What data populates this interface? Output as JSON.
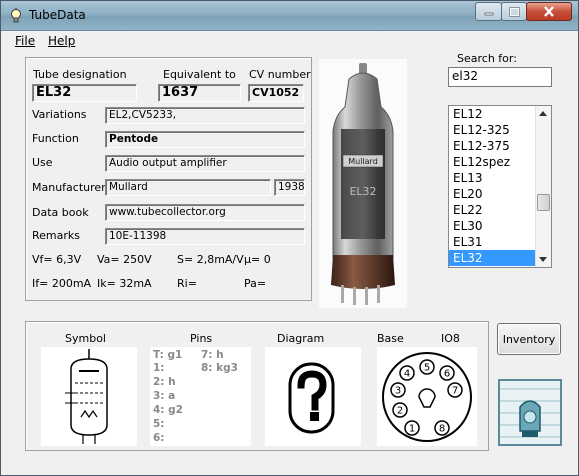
{
  "window": {
    "title": "TubeData"
  },
  "menu": {
    "file": "File",
    "help": "Help"
  },
  "labels": {
    "tube_designation": "Tube designation",
    "equivalent_to": "Equivalent to",
    "cv_number": "CV number",
    "variations": "Variations",
    "function": "Function",
    "use": "Use",
    "manufacturer": "Manufacturer",
    "data_book": "Data book",
    "remarks": "Remarks",
    "search_for": "Search for:"
  },
  "tube": {
    "designation": "EL32",
    "equivalent": "1637",
    "cv_number": "CV1052",
    "variations": "EL2,CV5233,",
    "function": "Pentode",
    "use": "Audio output amplifier",
    "manufacturer": "Mullard",
    "year": "1938",
    "data_book": "www.tubecollector.org",
    "remarks": "10E-11398"
  },
  "params": {
    "vf": "Vf= 6,3V",
    "va": "Va=  250V",
    "s": "S= 2,8mA/V",
    "mu": "µ=    0",
    "if": "If= 200mA",
    "ik": "Ik=   32mA",
    "ri": "Ri=",
    "pa": "Pa="
  },
  "search": {
    "value": "el32"
  },
  "tube_list": [
    "EL12",
    "EL12-325",
    "EL12-375",
    "EL12spez",
    "EL13",
    "EL20",
    "EL22",
    "EL30",
    "EL31",
    "EL32"
  ],
  "selected_tube": "EL32",
  "bottom": {
    "symbol_label": "Symbol",
    "pins_label": "Pins",
    "diagram_label": "Diagram",
    "base_label": "Base",
    "base_type": "IO8",
    "inventory_button": "Inventory"
  },
  "pins_left": [
    "T: g1",
    "1:",
    "2: h",
    "3: a",
    "4: g2",
    "5:",
    "6:"
  ],
  "pins_right": [
    "7: h",
    "8: kg3"
  ],
  "base_pins": [
    "1",
    "2",
    "3",
    "4",
    "5",
    "6",
    "7",
    "8"
  ],
  "photo_text": {
    "brand": "Mullard",
    "type": "EL32"
  }
}
